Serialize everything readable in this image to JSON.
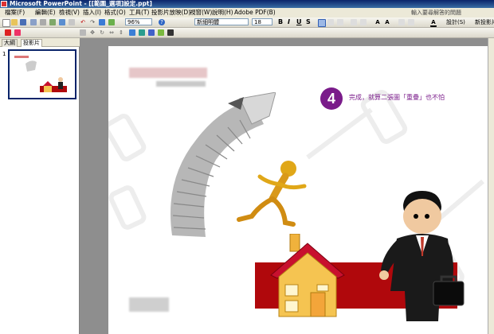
{
  "window": {
    "title": "Microsoft PowerPoint - [[範圍_選項]設定.ppt]"
  },
  "menu": {
    "items": [
      "檔案(F)",
      "編輯(E)",
      "檢視(V)",
      "插入(I)",
      "格式(O)",
      "工具(T)",
      "投影片放映(D)",
      "視窗(W)",
      "說明(H)",
      "Adobe PDF(B)"
    ],
    "help_placeholder": "輸入要尋解答的問題"
  },
  "toolbar": {
    "zoom": "96%",
    "font_name": "新細明體",
    "font_size": "18",
    "bold": "B",
    "italic": "I",
    "underline": "U",
    "shadow": "S",
    "design_label": "設計(S)",
    "new_slide_label": "新投影片(N)"
  },
  "left_pane": {
    "tab_outline": "大綱",
    "tab_slides": "投影片",
    "slide_number": "1"
  },
  "slide": {
    "step_number": "4",
    "caption": "完成，就算二張圖「重疊」也不怕"
  },
  "colors": {
    "titlebar": "#0a246a",
    "accent_purple": "#7a1b8a",
    "red_bar": "#b0080c",
    "house_roof": "#c8102e",
    "house_wall": "#f5c451"
  }
}
